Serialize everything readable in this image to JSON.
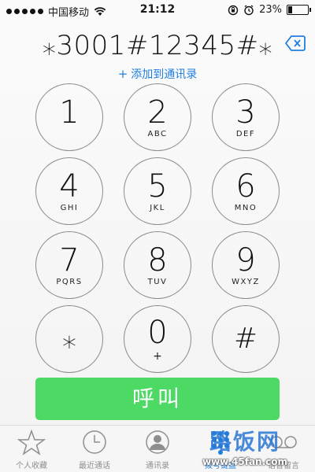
{
  "status_bar": {
    "carrier": "中国移动",
    "time": "21:12",
    "battery": "23%",
    "battery_level": 0.23
  },
  "dialer": {
    "number": "⁎3001#12345#⁎",
    "add_contact_label": "添加到通讯录",
    "add_icon": "+",
    "backspace_icon": "backspace-icon"
  },
  "keypad": [
    {
      "digit": "1",
      "letters": ""
    },
    {
      "digit": "2",
      "letters": "ABC"
    },
    {
      "digit": "3",
      "letters": "DEF"
    },
    {
      "digit": "4",
      "letters": "GHI"
    },
    {
      "digit": "5",
      "letters": "JKL"
    },
    {
      "digit": "6",
      "letters": "MNO"
    },
    {
      "digit": "7",
      "letters": "PQRS"
    },
    {
      "digit": "8",
      "letters": "TUV"
    },
    {
      "digit": "9",
      "letters": "WXYZ"
    },
    {
      "digit": "⁎",
      "letters": ""
    },
    {
      "digit": "0",
      "letters": "+"
    },
    {
      "digit": "#",
      "letters": ""
    }
  ],
  "call_button": {
    "label": "呼叫",
    "color": "#4cd964"
  },
  "tab_bar": {
    "tabs": [
      {
        "label": "个人收藏",
        "icon": "star-icon"
      },
      {
        "label": "最近通话",
        "icon": "clock-icon"
      },
      {
        "label": "通讯录",
        "icon": "contact-icon"
      },
      {
        "label": "拨号键盘",
        "icon": "keypad-icon"
      },
      {
        "label": "语音留言",
        "icon": "voicemail-icon"
      }
    ]
  },
  "watermark": {
    "logo": "路饭网",
    "url": "www.45fan.com"
  },
  "colors": {
    "accent": "#1f7fe0",
    "call_green": "#4cd964"
  }
}
